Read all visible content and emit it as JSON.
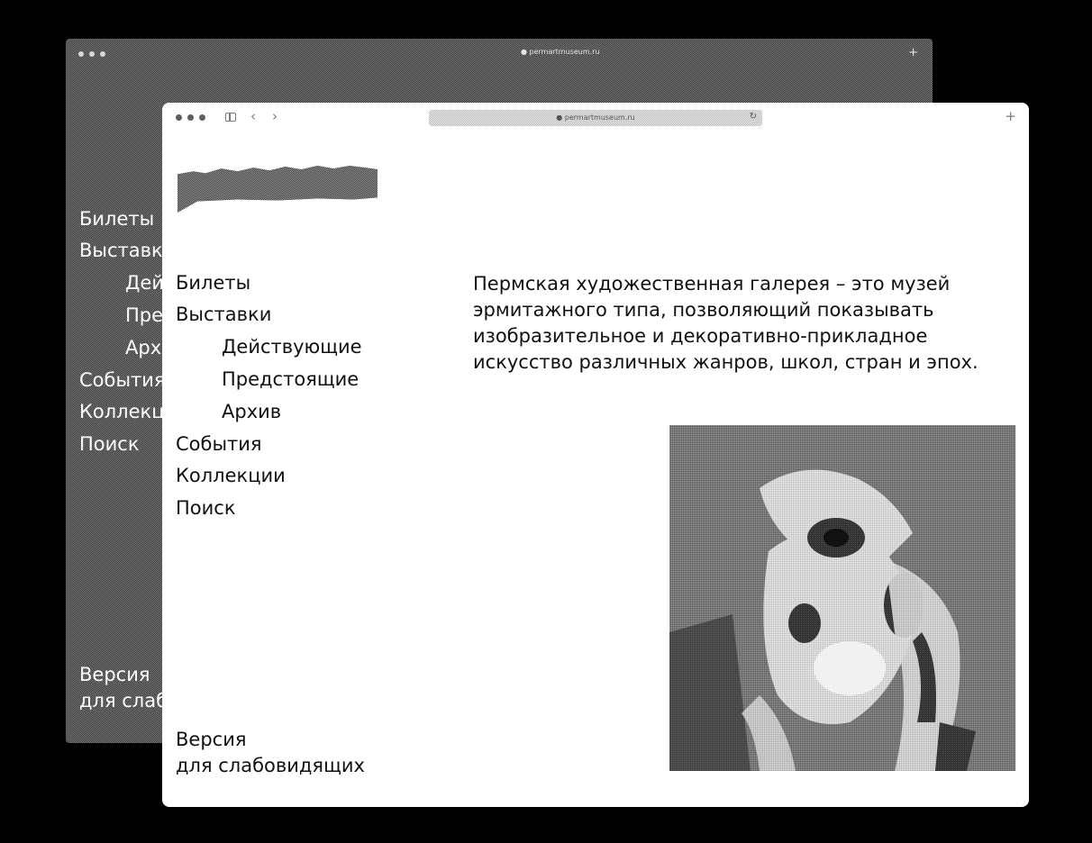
{
  "back_window": {
    "address": "● permartmuseum.ru",
    "new_tab_glyph": "+",
    "nav": {
      "tickets": "Билеты",
      "exhibitions": "Выставки",
      "current": "Действующие",
      "upcoming": "Предстоящие",
      "archive": "Архив",
      "events": "События",
      "collections": "Коллекции",
      "search": "Поиск"
    },
    "footer": {
      "line1": "Версия",
      "line2": "для слабовидящих"
    }
  },
  "front_window": {
    "toolbar": {
      "address": "● permartmuseum.ru",
      "back_glyph": "‹",
      "forward_glyph": "›",
      "reload_glyph": "↻",
      "new_tab_glyph": "+"
    },
    "nav": {
      "tickets": "Билеты",
      "exhibitions": "Выставки",
      "current": "Действующие",
      "upcoming": "Предстоящие",
      "archive": "Архив",
      "events": "События",
      "collections": "Коллекции",
      "search": "Поиск"
    },
    "footer": {
      "line1": "Версия",
      "line2": "для слабовидящих"
    },
    "description": {
      "line1": "Пермская художественная галерея – это музей",
      "line2": "эрмитажного типа, позволяющий показывать",
      "line3": "изобразительное и декоративно-прикладное",
      "line4": "искусство различных жанров, школ, стран и эпох."
    }
  },
  "icons": {
    "traffic_lights": "window-control-dots",
    "sidebar": "sidebar-toggle-icon",
    "logo": "museum-logo",
    "painting": "artwork-image"
  }
}
